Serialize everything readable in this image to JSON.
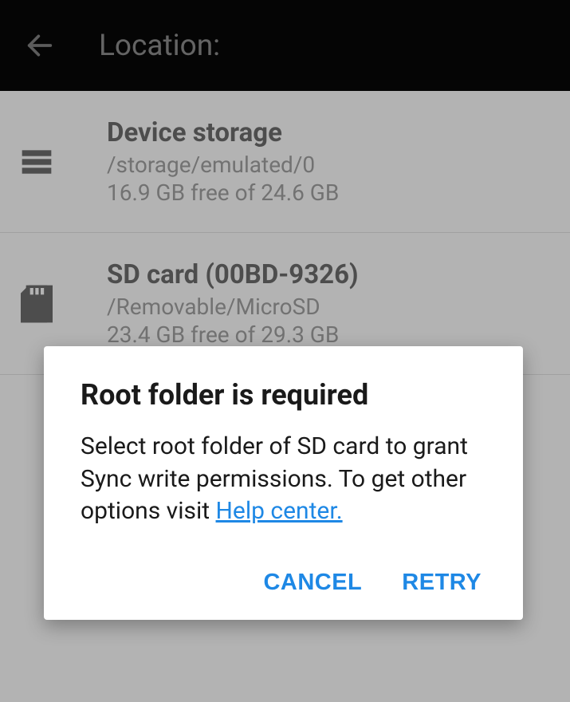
{
  "header": {
    "title": "Location:"
  },
  "storage": [
    {
      "name": "Device storage",
      "path": "/storage/emulated/0",
      "space": "16.9 GB free of 24.6 GB"
    },
    {
      "name": "SD card (00BD-9326)",
      "path": "/Removable/MicroSD",
      "space": "23.4 GB free of 29.3 GB"
    }
  ],
  "dialog": {
    "title": "Root folder is required",
    "message": "Select root folder of SD card to grant Sync write permissions. To get other options visit ",
    "link_text": "Help center.",
    "cancel": "CANCEL",
    "retry": "RETRY"
  }
}
